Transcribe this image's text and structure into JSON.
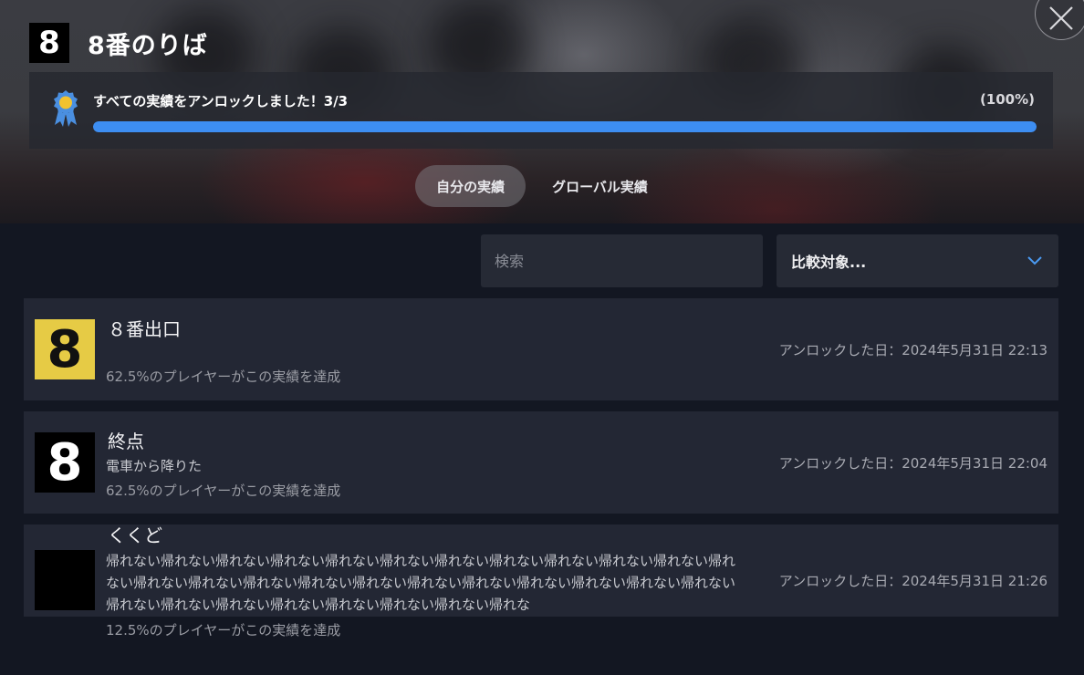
{
  "game": {
    "logo_text": "8",
    "title": "8番のりば"
  },
  "progress": {
    "text": "すべての実績をアンロックしました！3/3",
    "percent_label": "(100%)",
    "fraction": 1.0,
    "fill_color": "#3d8ef2"
  },
  "tabs": [
    {
      "label": "自分の実績",
      "active": true
    },
    {
      "label": "グローバル実績",
      "active": false
    }
  ],
  "search": {
    "placeholder": "検索",
    "value": ""
  },
  "compare": {
    "label": "比較対象...",
    "icon": "chevron-down-icon"
  },
  "achievements": [
    {
      "icon_text": "8",
      "icon_bg": "#e6cb45",
      "icon_fg": "#111111",
      "title": "８番出口",
      "description": "",
      "rarity": "62.5%のプレイヤーがこの実績を達成",
      "unlock_date": "アンロックした日：2024年5月31日 22:13"
    },
    {
      "icon_text": "8",
      "icon_bg": "#000000",
      "icon_fg": "#ffffff",
      "title": "終点",
      "description": "電車から降りた",
      "rarity": "62.5%のプレイヤーがこの実績を達成",
      "unlock_date": "アンロックした日：2024年5月31日 22:04"
    },
    {
      "icon_text": "",
      "icon_bg": "#000000",
      "icon_fg": "#ffffff",
      "title": "くくど",
      "description": "帰れない帰れない帰れない帰れない帰れない帰れない帰れない帰れない帰れない帰れない帰れない帰れない帰れない帰れない帰れない帰れない帰れない帰れない帰れない帰れない帰れない帰れない帰れない帰れない帰れない帰れない帰れない帰れない帰れない帰れない帰れな",
      "rarity": "12.5%のプレイヤーがこの実績を達成",
      "unlock_date": "アンロックした日：2024年5月31日 21:26"
    }
  ]
}
